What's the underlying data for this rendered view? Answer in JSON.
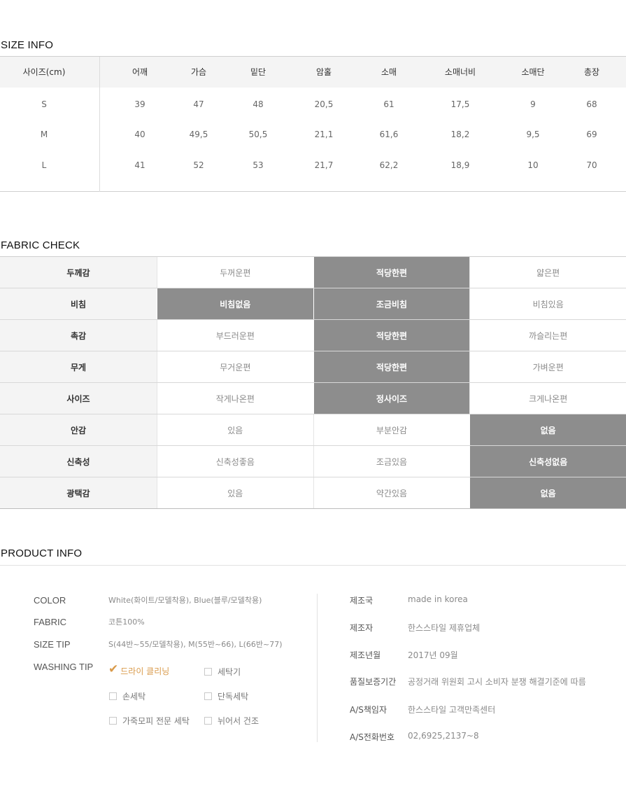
{
  "size_info": {
    "title": "SIZE INFO",
    "headers": [
      "사이즈(cm)",
      "어깨",
      "가슴",
      "밑단",
      "암홀",
      "소매",
      "소매너비",
      "소매단",
      "총장"
    ],
    "rows": [
      [
        "S",
        "39",
        "47",
        "48",
        "20,5",
        "61",
        "17,5",
        "9",
        "68"
      ],
      [
        "M",
        "40",
        "49,5",
        "50,5",
        "21,1",
        "61,6",
        "18,2",
        "9,5",
        "69"
      ],
      [
        "L",
        "41",
        "52",
        "53",
        "21,7",
        "62,2",
        "18,9",
        "10",
        "70"
      ]
    ]
  },
  "fabric_check": {
    "title": "FABRIC CHECK",
    "rows": [
      {
        "label": "두께감",
        "options": [
          "두꺼운편",
          "적당한편",
          "얇은편"
        ],
        "selected": [
          1
        ]
      },
      {
        "label": "비침",
        "options": [
          "비침없음",
          "조금비침",
          "비침있음"
        ],
        "selected": [
          0,
          1
        ]
      },
      {
        "label": "촉감",
        "options": [
          "부드러운편",
          "적당한편",
          "까슬리는편"
        ],
        "selected": [
          1
        ]
      },
      {
        "label": "무게",
        "options": [
          "무거운편",
          "적당한편",
          "가벼운편"
        ],
        "selected": [
          1
        ]
      },
      {
        "label": "사이즈",
        "options": [
          "작게나온편",
          "정사이즈",
          "크게나온편"
        ],
        "selected": [
          1
        ]
      },
      {
        "label": "안감",
        "options": [
          "있음",
          "부분안감",
          "없음"
        ],
        "selected": [
          2
        ]
      },
      {
        "label": "신축성",
        "options": [
          "신축성좋음",
          "조금있음",
          "신축성없음"
        ],
        "selected": [
          2
        ]
      },
      {
        "label": "광택감",
        "options": [
          "있음",
          "약간있음",
          "없음"
        ],
        "selected": [
          2
        ]
      }
    ]
  },
  "product_info": {
    "title": "PRODUCT INFO",
    "left": [
      {
        "label": "COLOR",
        "value": "White(화이트/모델착용), Blue(블루/모델착용)"
      },
      {
        "label": "FABRIC",
        "value": "코튼100%"
      },
      {
        "label": "SIZE TIP",
        "value": "S(44반~55/모델착용), M(55반~66), L(66반~77)"
      },
      {
        "label": "WASHING TIP",
        "value": ""
      }
    ],
    "washing": [
      {
        "label": "드라이 클리닝",
        "checked": true
      },
      {
        "label": "세탁기",
        "checked": false
      },
      {
        "label": "손세탁",
        "checked": false
      },
      {
        "label": "단독세탁",
        "checked": false
      },
      {
        "label": "가죽모피 전문 세탁",
        "checked": false
      },
      {
        "label": "뉘어서 건조",
        "checked": false
      }
    ],
    "right": [
      {
        "label": "제조국",
        "value": "made in korea"
      },
      {
        "label": "제조자",
        "value": "한스스타일 제휴업체"
      },
      {
        "label": "제조년월",
        "value": "2017년 09월"
      },
      {
        "label": "품질보증기간",
        "value": "공정거래 위원회 고시 소비자 분쟁 해결기준에 따름"
      },
      {
        "label": "A/S책임자",
        "value": "한스스타일 고객만족센터"
      },
      {
        "label": "A/S전화번호",
        "value": "02,6925,2137~8"
      }
    ]
  },
  "colors": {
    "selected_bg": "#8d8d8d",
    "label_bg": "#f4f4f4",
    "accent_check": "#d99a4a"
  }
}
